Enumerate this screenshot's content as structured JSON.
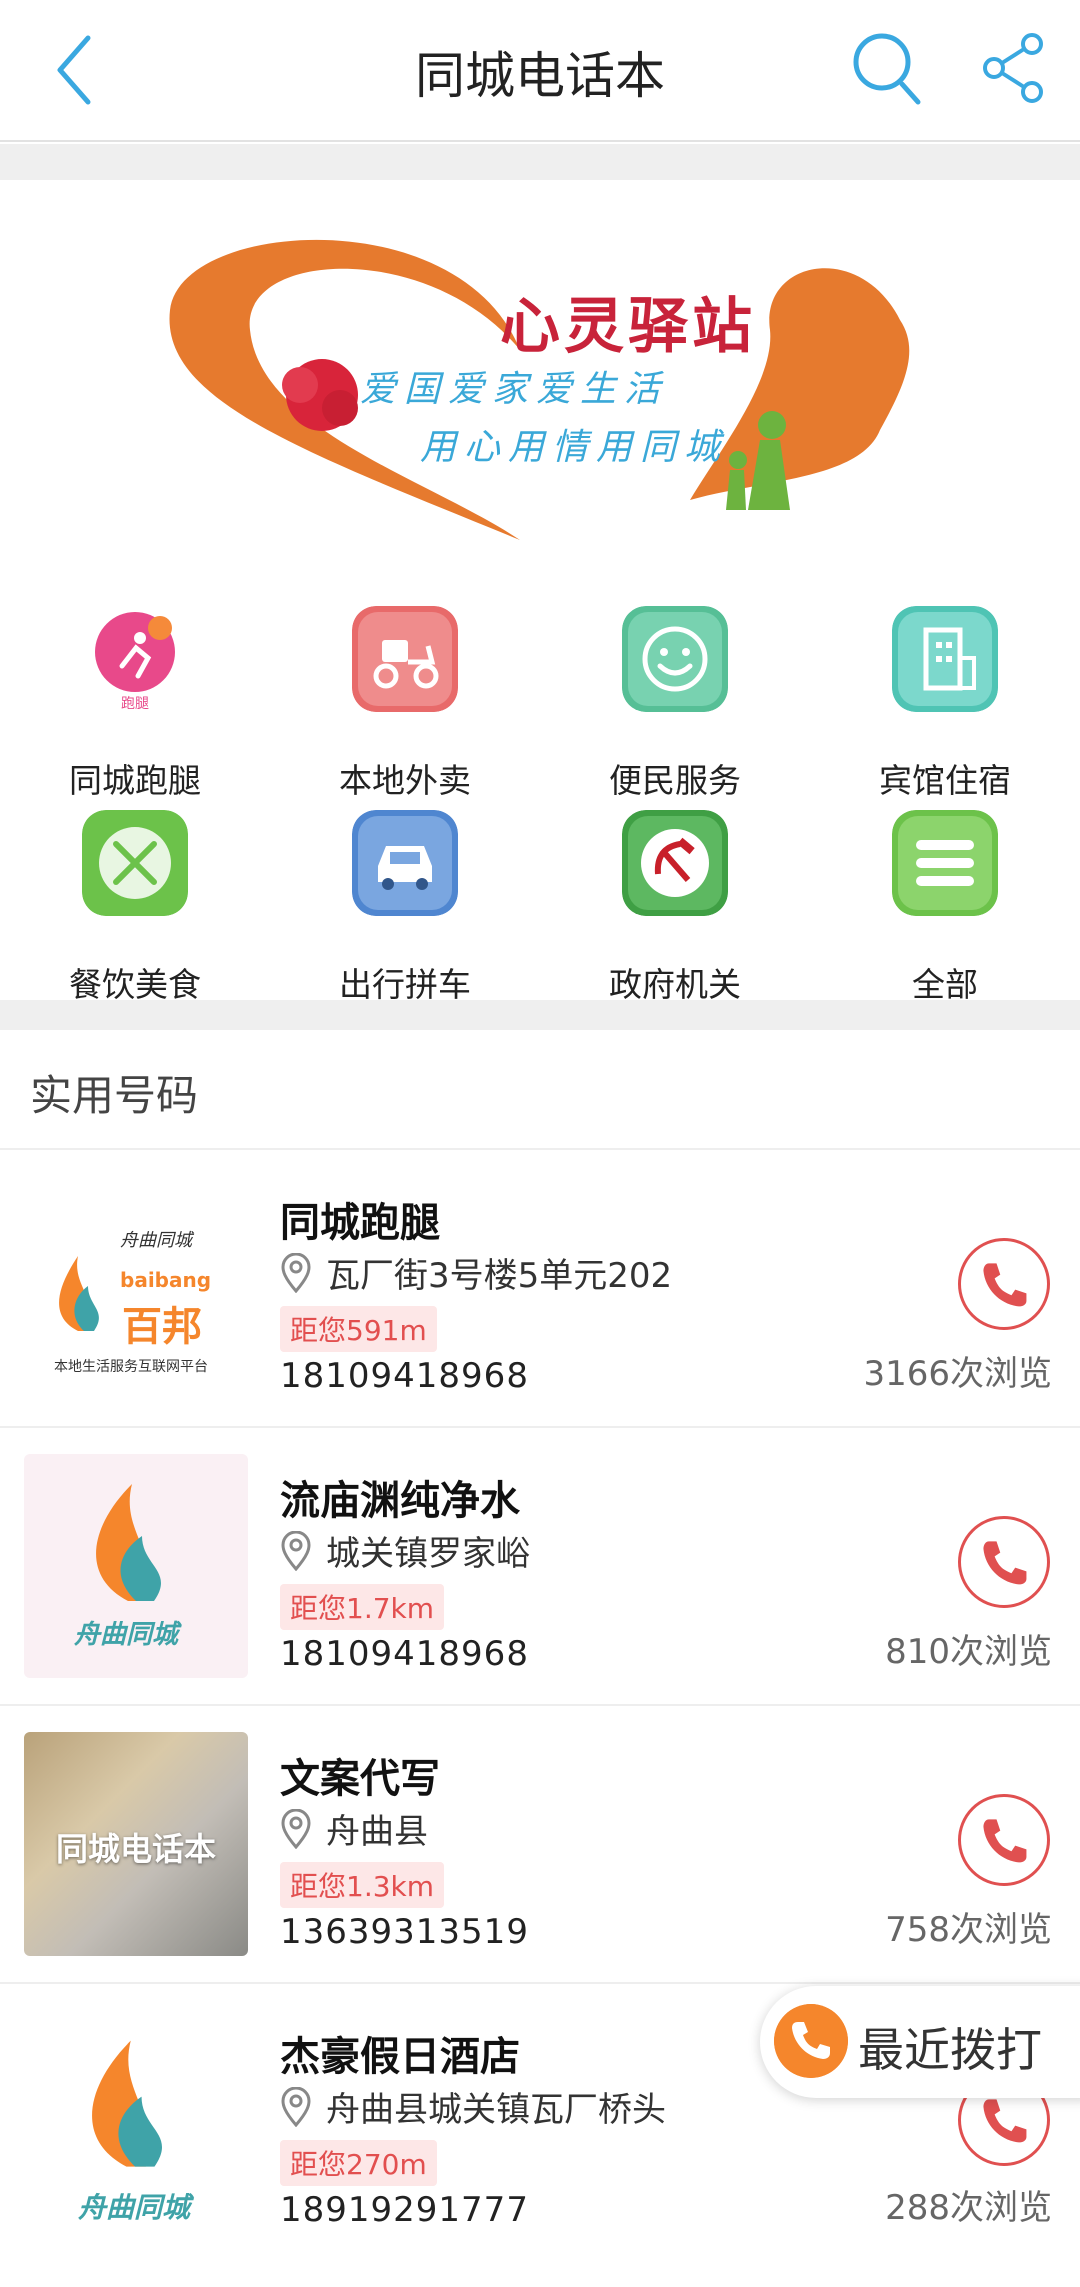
{
  "header": {
    "title": "同城电话本"
  },
  "banner": {
    "title": "心灵驿站",
    "slogan1": "爱国爱家爱生活",
    "slogan2": "用心用情用同城"
  },
  "categories": [
    {
      "label": "同城跑腿",
      "icon": "errand-icon",
      "color": "#e8498a",
      "badge": "跑腿"
    },
    {
      "label": "本地外卖",
      "icon": "scooter-icon",
      "color": "#e86a6a"
    },
    {
      "label": "便民服务",
      "icon": "smile-icon",
      "color": "#62c9a2"
    },
    {
      "label": "宾馆住宿",
      "icon": "building-icon",
      "color": "#5fcfc0"
    },
    {
      "label": "餐饮美食",
      "icon": "fork-knife-icon",
      "color": "#7ecf5c"
    },
    {
      "label": "出行拼车",
      "icon": "car-icon",
      "color": "#5a8fd6"
    },
    {
      "label": "政府机关",
      "icon": "hammer-sickle-icon",
      "color": "#4caf50"
    },
    {
      "label": "全部",
      "icon": "menu-icon",
      "color": "#7ecf5c"
    }
  ],
  "section": {
    "title": "实用号码"
  },
  "listings": [
    {
      "name": "同城跑腿",
      "address": "瓦厂街3号楼5单元202",
      "distance": "距您591m",
      "phone": "18109418968",
      "views": "3166次浏览",
      "thumb_top": "舟曲同城",
      "thumb_en": "baibang",
      "thumb_cn": "百邦",
      "thumb_sub": "本地生活服务互联网平台"
    },
    {
      "name": "流庙渊纯净水",
      "address": "城关镇罗家峪",
      "distance": "距您1.7km",
      "phone": "18109418968",
      "views": "810次浏览",
      "thumb_cn": "舟曲同城"
    },
    {
      "name": "文案代写",
      "address": "舟曲县",
      "distance": "距您1.3km",
      "phone": "13639313519",
      "views": "758次浏览",
      "thumb_cn": "同城电话本"
    },
    {
      "name": "杰豪假日酒店",
      "address": "舟曲县城关镇瓦厂桥头",
      "distance": "距您270m",
      "phone": "18919291777",
      "views": "288次浏览",
      "thumb_cn": "舟曲同城"
    }
  ],
  "floating": {
    "recent_label": "最近拨打"
  }
}
